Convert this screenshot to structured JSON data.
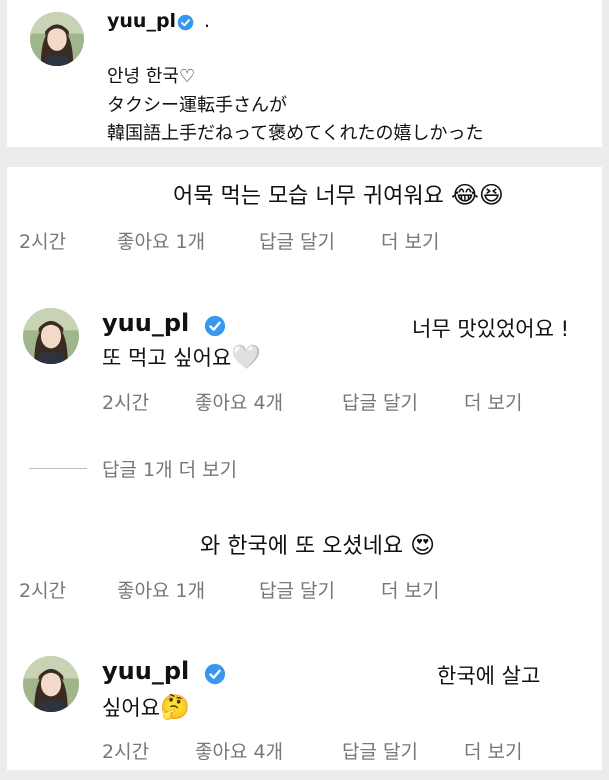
{
  "post": {
    "username": "yuu_pl",
    "after_badge": ".",
    "caption_lines": [
      "안녕 한국♡",
      "タクシー運転手さんが",
      "韓国語上手だねって褒めてくれたの嬉しかった"
    ]
  },
  "comments": [
    {
      "text": "어묵 먹는 모습 너무 귀여워요",
      "emoji": "😂😆",
      "time": "2시간",
      "likes": "좋아요 1개",
      "reply": "답글 달기",
      "more": "더 보기"
    },
    {
      "username": "yuu_pl",
      "text_line1": "너무 맛있었어요 !",
      "text_line2": "또 먹고 싶어요",
      "emoji": "🤍",
      "time": "2시간",
      "likes": "좋아요 4개",
      "reply": "답글 달기",
      "more": "더 보기"
    },
    {
      "text": "와 한국에 또 오셨네요",
      "emoji": "😍",
      "time": "2시간",
      "likes": "좋아요 1개",
      "reply": "답글 달기",
      "more": "더 보기"
    },
    {
      "username": "yuu_pl",
      "text_line1": "한국에 살고",
      "text_line2": "싶어요",
      "emoji": "🤔",
      "time": "2시간",
      "likes": "좋아요 4개",
      "reply": "답글 달기",
      "more": "더 보기"
    }
  ],
  "view_replies": "답글 1개 더 보기",
  "colors": {
    "verified": "#3897f0",
    "meta": "#777777",
    "background": "#ececec"
  }
}
